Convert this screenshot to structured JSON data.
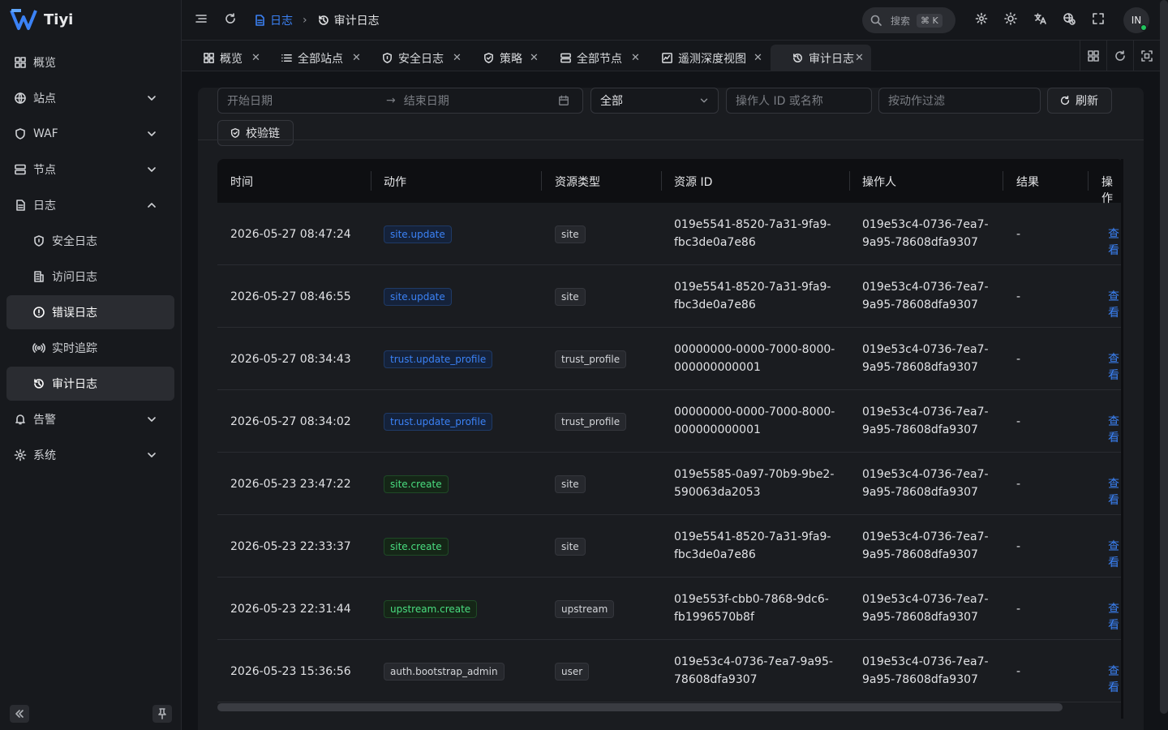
{
  "app": {
    "name": "Tiyi"
  },
  "sidebar": {
    "items": [
      {
        "label": "概览",
        "icon": "dashboard-icon"
      },
      {
        "label": "站点",
        "icon": "globe-icon"
      },
      {
        "label": "WAF",
        "icon": "shield-icon"
      },
      {
        "label": "节点",
        "icon": "server-icon"
      },
      {
        "label": "日志",
        "icon": "file-icon"
      },
      {
        "label": "安全日志",
        "icon": "shield-icon"
      },
      {
        "label": "访问日志",
        "icon": "log-icon"
      },
      {
        "label": "错误日志",
        "icon": "alert-circle-icon"
      },
      {
        "label": "实时追踪",
        "icon": "broadcast-icon"
      },
      {
        "label": "审计日志",
        "icon": "history-icon"
      },
      {
        "label": "告警",
        "icon": "bell-icon"
      },
      {
        "label": "系统",
        "icon": "gear-icon"
      }
    ]
  },
  "header": {
    "breadcrumb_parent": "日志",
    "breadcrumb_current": "审计日志",
    "search_placeholder": "搜索",
    "search_shortcut": "⌘ K",
    "avatar_initials": "IN"
  },
  "tabs": [
    {
      "label": "概览"
    },
    {
      "label": "全部站点"
    },
    {
      "label": "安全日志"
    },
    {
      "label": "策略"
    },
    {
      "label": "全部节点"
    },
    {
      "label": "遥测深度视图"
    },
    {
      "label": "审计日志"
    }
  ],
  "filters": {
    "start_date": "开始日期",
    "end_date": "结束日期",
    "result_select": "全部",
    "operator_placeholder": "操作人 ID 或名称",
    "action_placeholder": "按动作过滤",
    "refresh_label": "刷新",
    "verify_label": "校验链"
  },
  "table": {
    "columns": [
      "时间",
      "动作",
      "资源类型",
      "资源 ID",
      "操作人",
      "结果",
      "操作"
    ],
    "rows": [
      {
        "time": "2026-05-27 08:47:24",
        "action": "site.update",
        "action_color": "blue",
        "resource_type": "site",
        "resource_id_1": "019e5541-8520-7a31-9fa9-",
        "resource_id_2": "fbc3de0a7e86",
        "operator_1": "019e53c4-0736-7ea7-",
        "operator_2": "9a95-78608dfa9307",
        "result": "-",
        "op": "查看"
      },
      {
        "time": "2026-05-27 08:46:55",
        "action": "site.update",
        "action_color": "blue",
        "resource_type": "site",
        "resource_id_1": "019e5541-8520-7a31-9fa9-",
        "resource_id_2": "fbc3de0a7e86",
        "operator_1": "019e53c4-0736-7ea7-",
        "operator_2": "9a95-78608dfa9307",
        "result": "-",
        "op": "查看"
      },
      {
        "time": "2026-05-27 08:34:43",
        "action": "trust.update_profile",
        "action_color": "blue",
        "resource_type": "trust_profile",
        "resource_id_1": "00000000-0000-7000-8000-",
        "resource_id_2": "000000000001",
        "operator_1": "019e53c4-0736-7ea7-",
        "operator_2": "9a95-78608dfa9307",
        "result": "-",
        "op": "查看"
      },
      {
        "time": "2026-05-27 08:34:02",
        "action": "trust.update_profile",
        "action_color": "blue",
        "resource_type": "trust_profile",
        "resource_id_1": "00000000-0000-7000-8000-",
        "resource_id_2": "000000000001",
        "operator_1": "019e53c4-0736-7ea7-",
        "operator_2": "9a95-78608dfa9307",
        "result": "-",
        "op": "查看"
      },
      {
        "time": "2026-05-23 23:47:22",
        "action": "site.create",
        "action_color": "green",
        "resource_type": "site",
        "resource_id_1": "019e5585-0a97-70b9-9be2-",
        "resource_id_2": "590063da2053",
        "operator_1": "019e53c4-0736-7ea7-",
        "operator_2": "9a95-78608dfa9307",
        "result": "-",
        "op": "查看"
      },
      {
        "time": "2026-05-23 22:33:37",
        "action": "site.create",
        "action_color": "green",
        "resource_type": "site",
        "resource_id_1": "019e5541-8520-7a31-9fa9-",
        "resource_id_2": "fbc3de0a7e86",
        "operator_1": "019e53c4-0736-7ea7-",
        "operator_2": "9a95-78608dfa9307",
        "result": "-",
        "op": "查看"
      },
      {
        "time": "2026-05-23 22:31:44",
        "action": "upstream.create",
        "action_color": "green",
        "resource_type": "upstream",
        "resource_id_1": "019e553f-cbb0-7868-9dc6-",
        "resource_id_2": "fb1996570b8f",
        "operator_1": "019e53c4-0736-7ea7-",
        "operator_2": "9a95-78608dfa9307",
        "result": "-",
        "op": "查看"
      },
      {
        "time": "2026-05-23 15:36:56",
        "action": "auth.bootstrap_admin",
        "action_color": "gray",
        "resource_type": "user",
        "resource_id_1": "019e53c4-0736-7ea7-9a95-",
        "resource_id_2": "78608dfa9307",
        "operator_1": "019e53c4-0736-7ea7-",
        "operator_2": "9a95-78608dfa9307",
        "result": "-",
        "op": "查看"
      }
    ]
  },
  "colors": {
    "accent": "#3b82f6",
    "success": "#22c55e",
    "background": "#111317"
  }
}
